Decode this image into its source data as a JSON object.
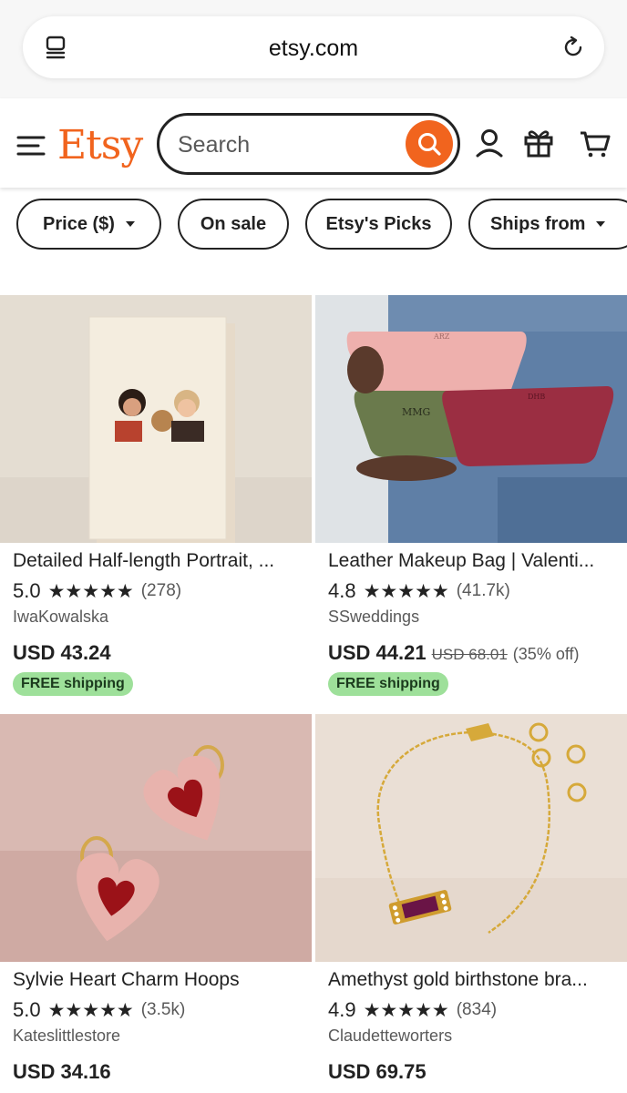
{
  "browser": {
    "url": "etsy.com",
    "left_icon": "tabs-icon",
    "right_icon": "reload-icon"
  },
  "header": {
    "logo": "Etsy",
    "search_placeholder": "Search",
    "icons": [
      "menu-icon",
      "search-icon",
      "account-icon",
      "gift-icon",
      "cart-icon"
    ],
    "brand_color": "#f1641e"
  },
  "filters": [
    {
      "label": "Price ($)",
      "dropdown": true
    },
    {
      "label": "On sale",
      "dropdown": false
    },
    {
      "label": "Etsy's Picks",
      "dropdown": false
    },
    {
      "label": "Ships from",
      "dropdown": true
    }
  ],
  "products": [
    {
      "title": "Detailed Half-length Portrait, ...",
      "rating": "5.0",
      "stars": "★★★★★",
      "reviews": "(278)",
      "shop": "IwaKowalska",
      "price": "USD 43.24",
      "old_price": "",
      "discount": "",
      "shipping": "FREE shipping"
    },
    {
      "title": "Leather Makeup Bag | Valenti...",
      "rating": "4.8",
      "stars": "★★★★★",
      "reviews": "(41.7k)",
      "shop": "SSweddings",
      "price": "USD 44.21",
      "old_price": "USD 68.01",
      "discount": "(35% off)",
      "shipping": "FREE shipping",
      "bag_monograms": [
        "ARZ",
        "MMG",
        "DHB"
      ]
    },
    {
      "title": "Sylvie Heart Charm Hoops",
      "rating": "5.0",
      "stars": "★★★★★",
      "reviews": "(3.5k)",
      "shop": "Kateslittlestore",
      "price": "USD 34.16",
      "old_price": "",
      "discount": "",
      "shipping": ""
    },
    {
      "title": "Amethyst gold birthstone bra...",
      "rating": "4.9",
      "stars": "★★★★★",
      "reviews": "(834)",
      "shop": "Claudetteworters",
      "price": "USD 69.75",
      "old_price": "",
      "discount": "",
      "shipping": ""
    }
  ]
}
